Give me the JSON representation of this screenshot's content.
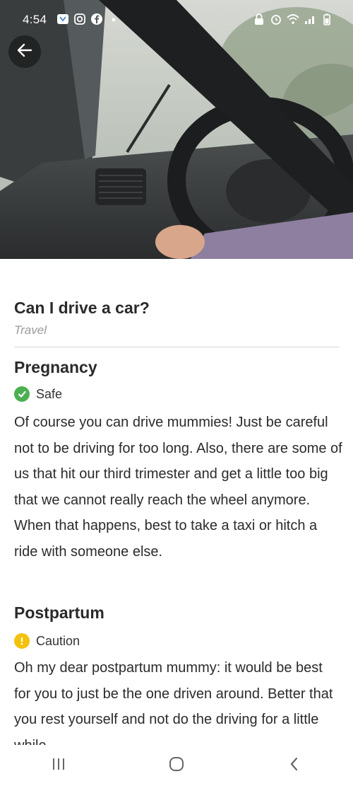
{
  "status_bar": {
    "time": "4:54",
    "left_icons": [
      "notification-icon",
      "instagram-icon",
      "facebook-icon",
      "dot-icon"
    ],
    "right_icons": [
      "lock-icon",
      "alarm-icon",
      "wifi-icon",
      "signal-icon",
      "battery-icon"
    ]
  },
  "header": {
    "back_icon": "arrow-left-icon"
  },
  "article": {
    "title": "Can I drive a car?",
    "category": "Travel",
    "sections": [
      {
        "heading": "Pregnancy",
        "status": "Safe",
        "status_icon": "check-icon",
        "status_color": "#4caf50",
        "body": "Of course you can drive mummies! Just be careful not to be driving for too long. Also, there are some of us that hit our third trimester and get a little too big that we cannot really reach the wheel anymore. When that happens, best to take a taxi or hitch a ride with someone else."
      },
      {
        "heading": "Postpartum",
        "status": "Caution",
        "status_icon": "exclamation-icon",
        "status_color": "#f4c20d",
        "body": "Oh my dear postpartum mummy: it would be best for you to just be the one driven around. Better that you rest yourself and not do the driving for a little while."
      }
    ]
  },
  "nav": {
    "recent_icon": "recent-apps-icon",
    "home_icon": "home-icon",
    "back_icon": "back-chevron-icon"
  }
}
